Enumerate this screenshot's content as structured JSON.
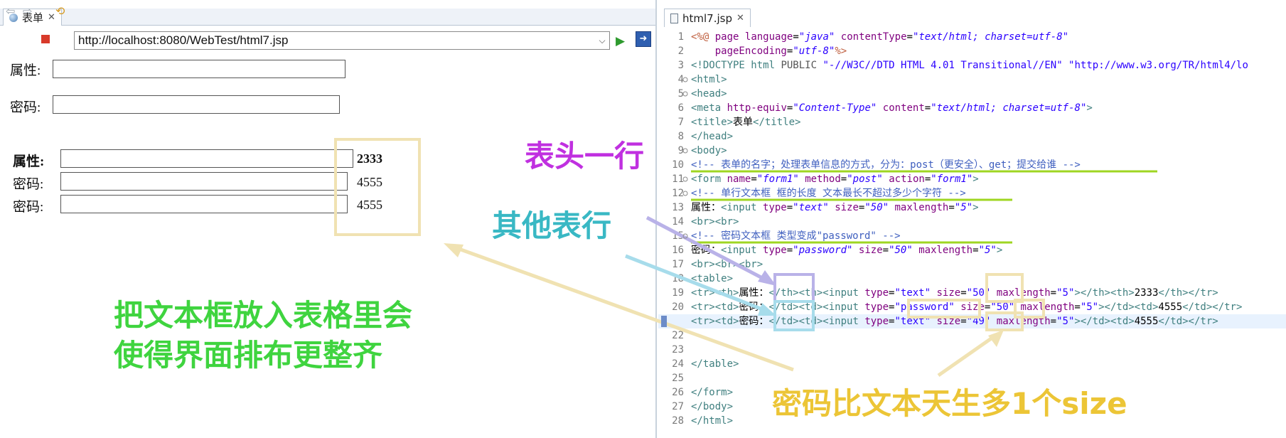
{
  "browser": {
    "tab_label": "表单",
    "url": "http://localhost:8080/WebTest/html7.jsp",
    "form": {
      "attr_label": "属性:",
      "pwd_label": "密码:"
    },
    "table": {
      "rows": [
        {
          "label": "属性:",
          "value": "2333"
        },
        {
          "label": "密码:",
          "value": "4555"
        },
        {
          "label": "密码:",
          "value": "4555"
        }
      ]
    }
  },
  "editor": {
    "tab_label": "html7.jsp",
    "line_numbers": [
      "1",
      "2",
      "3",
      "4",
      "5",
      "6",
      "7",
      "8",
      "9",
      "10",
      "11",
      "12",
      "13",
      "14",
      "15",
      "16",
      "17",
      "18",
      "19",
      "20",
      "21",
      "22",
      "23",
      "24",
      "25",
      "26",
      "27",
      "28"
    ]
  },
  "annotations": {
    "header_row": "表头一行",
    "other_rows": "其他表行",
    "note_line1": "把文本框放入表格里会",
    "note_line2": "使得界面排布更整齐",
    "password_note": "密码比文本天生多1个size",
    "colors": {
      "purple": "#c030e0",
      "teal": "#39b8c4",
      "green": "#3fd43f",
      "gold": "#ecc536",
      "underline": "#9fd622",
      "box_beige": "#f0e2b2",
      "box_purple": "#b9b2e8",
      "box_cyan": "#a7dceb"
    }
  }
}
